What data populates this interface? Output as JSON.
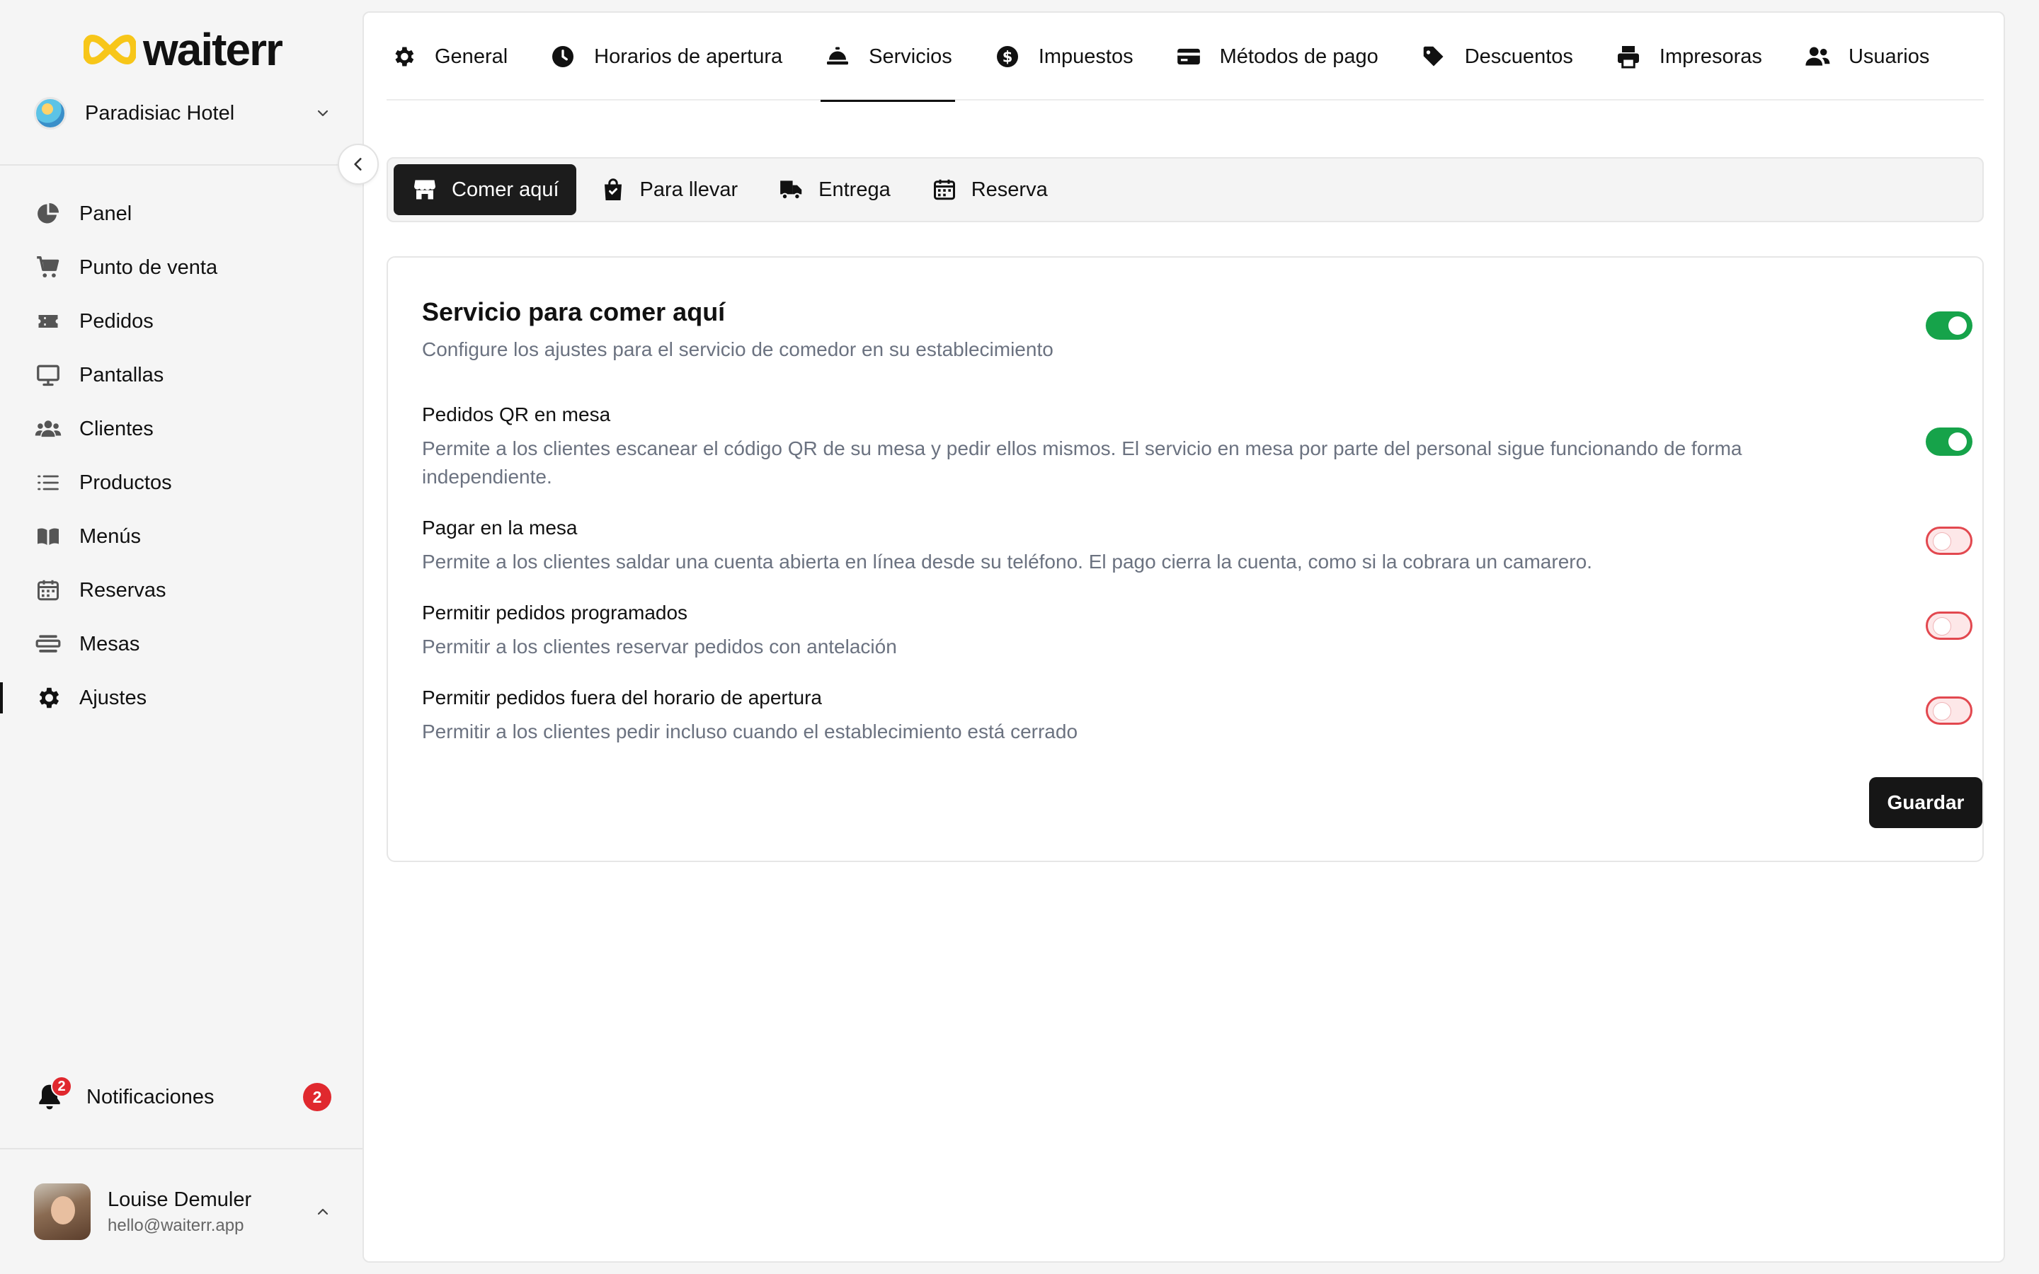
{
  "app": {
    "logo_text": "waiterr",
    "brand_color": "#f7c619"
  },
  "workspace": {
    "name": "Paradisiac Hotel"
  },
  "nav": {
    "items": [
      {
        "label": "Panel",
        "icon": "pie-chart-icon"
      },
      {
        "label": "Punto de venta",
        "icon": "shopping-cart-icon"
      },
      {
        "label": "Pedidos",
        "icon": "ticket-icon"
      },
      {
        "label": "Pantallas",
        "icon": "monitor-icon"
      },
      {
        "label": "Clientes",
        "icon": "users-icon"
      },
      {
        "label": "Productos",
        "icon": "list-icon"
      },
      {
        "label": "Menús",
        "icon": "book-icon"
      },
      {
        "label": "Reservas",
        "icon": "calendar-icon"
      },
      {
        "label": "Mesas",
        "icon": "table-icon"
      },
      {
        "label": "Ajustes",
        "icon": "gear-icon",
        "active": true
      }
    ]
  },
  "notifications": {
    "label": "Notificaciones",
    "count": "2"
  },
  "user": {
    "name": "Louise Demuler",
    "email": "hello@waiterr.app"
  },
  "tabs": [
    {
      "label": "General",
      "icon": "gear-icon"
    },
    {
      "label": "Horarios de apertura",
      "icon": "clock-icon"
    },
    {
      "label": "Servicios",
      "icon": "cloche-icon",
      "active": true
    },
    {
      "label": "Impuestos",
      "icon": "dollar-circle-icon"
    },
    {
      "label": "Métodos de pago",
      "icon": "credit-card-icon"
    },
    {
      "label": "Descuentos",
      "icon": "tag-icon"
    },
    {
      "label": "Impresoras",
      "icon": "printer-icon"
    },
    {
      "label": "Usuarios",
      "icon": "user-group-icon"
    }
  ],
  "subtabs": [
    {
      "label": "Comer aquí",
      "icon": "store-icon",
      "active": true
    },
    {
      "label": "Para llevar",
      "icon": "bag-icon"
    },
    {
      "label": "Entrega",
      "icon": "truck-icon"
    },
    {
      "label": "Reserva",
      "icon": "calendar-icon"
    }
  ],
  "card": {
    "title": "Servicio para comer aquí",
    "subtitle": "Configure los ajustes para el servicio de comedor en su establecimiento",
    "enabled": true,
    "settings": [
      {
        "title": "Pedidos QR en mesa",
        "desc": "Permite a los clientes escanear el código QR de su mesa y pedir ellos mismos. El servicio en mesa por parte del personal sigue funcionando de forma independiente.",
        "enabled": true
      },
      {
        "title": "Pagar en la mesa",
        "desc": "Permite a los clientes saldar una cuenta abierta en línea desde su teléfono. El pago cierra la cuenta, como si la cobrara un camarero.",
        "enabled": false
      },
      {
        "title": "Permitir pedidos programados",
        "desc": "Permitir a los clientes reservar pedidos con antelación",
        "enabled": false
      },
      {
        "title": "Permitir pedidos fuera del horario de apertura",
        "desc": "Permitir a los clientes pedir incluso cuando el establecimiento está cerrado",
        "enabled": false
      }
    ],
    "save_label": "Guardar"
  },
  "colors": {
    "toggle_on": "#16a34a",
    "toggle_off_border": "#e2484f",
    "badge": "#e0282e"
  }
}
